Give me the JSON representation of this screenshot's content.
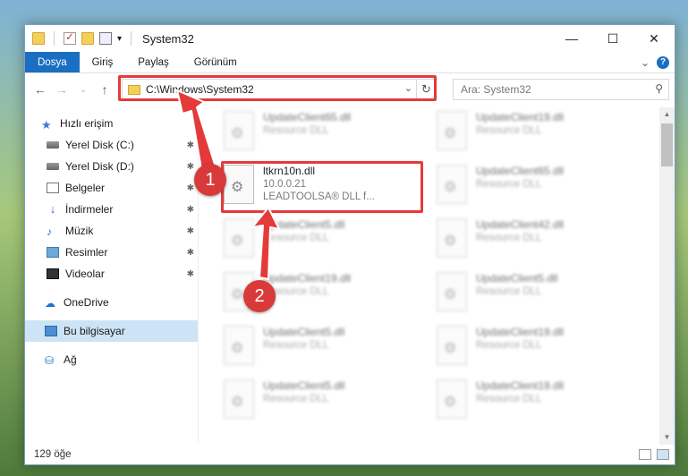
{
  "window": {
    "title": "System32",
    "controls": {
      "minimize": "—",
      "maximize": "☐",
      "close": "✕"
    }
  },
  "ribbon": {
    "tabs": [
      "Dosya",
      "Giriş",
      "Paylaş",
      "Görünüm"
    ],
    "active_tab": "Dosya",
    "expand": "⌄",
    "help": "?"
  },
  "navigation": {
    "back": "←",
    "forward": "→",
    "recent": "⌄",
    "up": "↑",
    "address": "C:\\Windows\\System32",
    "dropdown": "⌄",
    "refresh": "↻",
    "search_placeholder": "Ara: System32",
    "search_icon": "⚲"
  },
  "sidebar": {
    "quick_access": "Hızlı erişim",
    "items": [
      {
        "label": "Yerel Disk (C:)",
        "icon": "disk-icon",
        "pinned": true
      },
      {
        "label": "Yerel Disk (D:)",
        "icon": "disk-icon",
        "pinned": true
      },
      {
        "label": "Belgeler",
        "icon": "documents-icon",
        "pinned": true
      },
      {
        "label": "İndirmeler",
        "icon": "downloads-icon",
        "pinned": true
      },
      {
        "label": "Müzik",
        "icon": "music-icon",
        "pinned": true
      },
      {
        "label": "Resimler",
        "icon": "pictures-icon",
        "pinned": true
      },
      {
        "label": "Videolar",
        "icon": "videos-icon",
        "pinned": true
      }
    ],
    "onedrive": "OneDrive",
    "this_pc": "Bu bilgisayar",
    "network": "Ağ",
    "pin_glyph": "📌"
  },
  "files": {
    "left": [
      {
        "name": "UpdateClient65.dll",
        "sub": "Resource DLL"
      },
      {
        "name": "ltkrn10n.dll",
        "sub": "10.0.0.21",
        "sub2": "LEADTOOLSA® DLL f...",
        "highlighted": true
      },
      {
        "name": "UpdateClient5.dll",
        "sub": "Resource DLL"
      },
      {
        "name": "UpdateClient19.dll",
        "sub": "Resource DLL"
      },
      {
        "name": "UpdateClient5.dll",
        "sub": "Resource DLL"
      },
      {
        "name": "UpdateClient5.dll",
        "sub": "Resource DLL"
      }
    ],
    "right": [
      {
        "name": "UpdateClient19.dll",
        "sub": "Resource DLL"
      },
      {
        "name": "UpdateClient65.dll",
        "sub": "Resource DLL"
      },
      {
        "name": "UpdateClient42.dll",
        "sub": "Resource DLL"
      },
      {
        "name": "UpdateClient5.dll",
        "sub": "Resource DLL"
      },
      {
        "name": "UpdateClient19.dll",
        "sub": "Resource DLL"
      },
      {
        "name": "UpdateClient19.dll",
        "sub": "Resource DLL"
      }
    ]
  },
  "annotations": {
    "step1": "1",
    "step2": "2",
    "highlight_color": "#e53a3a"
  },
  "status": {
    "item_count": "129 öğe"
  },
  "colors": {
    "accent": "#1a6fc2",
    "selected": "#cde4f7"
  }
}
